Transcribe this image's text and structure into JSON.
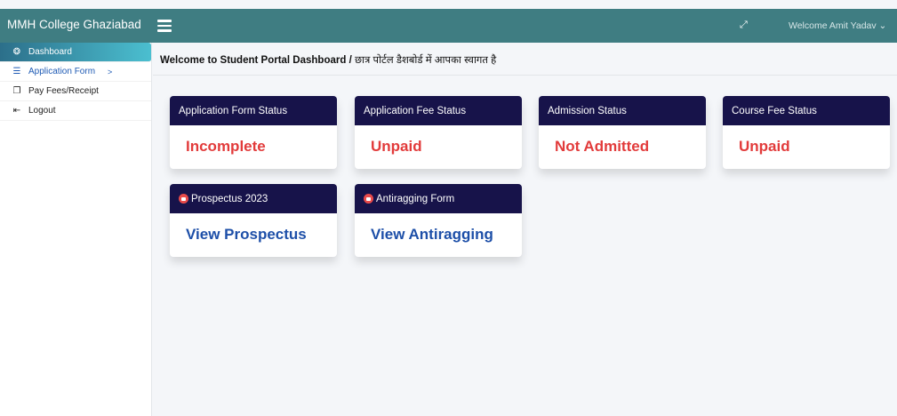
{
  "header": {
    "brand": "MMH College Ghaziabad",
    "user": "Welcome Amit Yadav ⌄"
  },
  "sidebar": {
    "items": [
      {
        "label": "Dashboard",
        "icon": "dashboard-icon",
        "glyph": "❂"
      },
      {
        "label": "Application Form",
        "icon": "list-icon",
        "glyph": "☰",
        "chevron": ">"
      },
      {
        "label": "Pay Fees/Receipt",
        "icon": "windows-icon",
        "glyph": "❐"
      },
      {
        "label": "Logout",
        "icon": "logout-icon",
        "glyph": "⇤"
      }
    ]
  },
  "main": {
    "welcome": "Welcome to Student Portal Dashboard / ",
    "welcome_hindi": "छात्र पोर्टल डैशबोर्ड में आपका स्वागत है"
  },
  "status_cards": [
    {
      "title": "Application Form Status",
      "value": "Incomplete"
    },
    {
      "title": "Application Fee Status",
      "value": "Unpaid"
    },
    {
      "title": "Admission Status",
      "value": "Not Admitted"
    },
    {
      "title": "Course Fee Status",
      "value": "Unpaid"
    }
  ],
  "doc_cards": [
    {
      "title": "Prospectus 2023",
      "link": "View Prospectus"
    },
    {
      "title": "Antiragging Form",
      "link": "View Antiragging"
    }
  ],
  "colors": {
    "topbar": "#3f7d82",
    "card_head": "#17134a",
    "status_red": "#e23b3b",
    "link_blue": "#1d4fa8"
  }
}
